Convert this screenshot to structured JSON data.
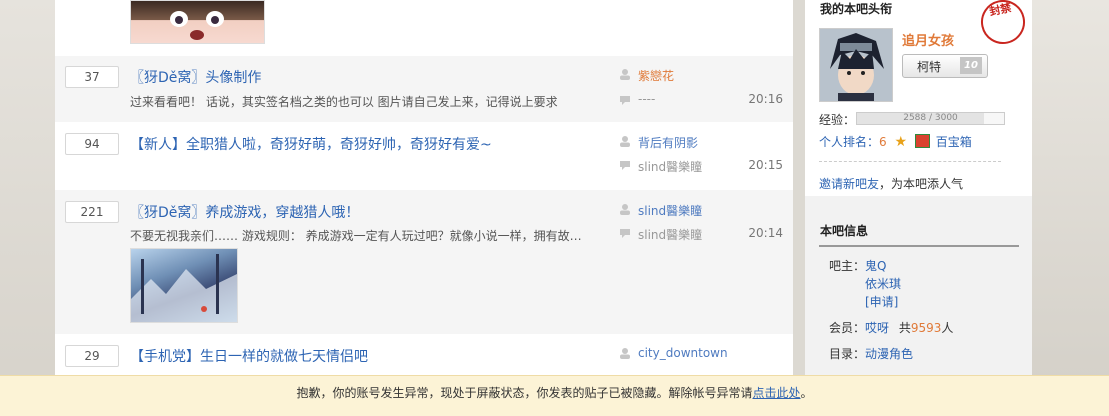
{
  "threads": [
    {
      "replies": "37",
      "title": "〖犽Dě窝〗头像制作",
      "abstract": "过来看看吧！ 话说，其实签名档之类的也可以 图片请自己发上来，记得说上要求",
      "author": "紫戀花",
      "last_replier": "----",
      "time": "20:16"
    },
    {
      "replies": "94",
      "title": "【新人】全职猎人啦，奇犽好萌，奇犽好帅，奇犽好有爱~",
      "author": "背后有阴影",
      "last_replier": "slind醫樂瞳",
      "time": "20:15"
    },
    {
      "replies": "221",
      "title": "〖犽Dě窝〗养成游戏，穿越猎人哦！",
      "abstract": "不要无视我亲们…… 游戏规则： 养成游戏一定有人玩过吧？就像小说一样，拥有故…",
      "author": "slind醫樂瞳",
      "last_replier": "slind醫樂瞳",
      "time": "20:14"
    },
    {
      "replies": "29",
      "title": "【手机党】生日一样的就做七天情侣吧",
      "author": "city_downtown",
      "last_replier": "",
      "time": ""
    }
  ],
  "sidebar": {
    "my_title_heading": "我的本吧头衔",
    "username": "追月女孩",
    "seal_text": "封禁",
    "badge_label": "柯特",
    "badge_level": "10",
    "exp_label": "经验：",
    "exp_value": "2588 / 3000",
    "exp_progress": 0.8627,
    "rank_label": "个人排名：",
    "rank_value": "6",
    "treasure_label": "百宝箱",
    "invite_link": "邀请新吧友",
    "invite_text": "，为本吧添人气",
    "info_heading": "本吧信息",
    "owner_label": "吧主：",
    "owners": [
      "鬼Q",
      "依米琪",
      "[申请]"
    ],
    "members_label": "会员：",
    "members_name": "哎呀",
    "members_total_prefix": "共",
    "members_count": "9593",
    "members_unit": "人",
    "catalog_label": "目录：",
    "catalog_value": "动漫角色"
  },
  "notice": {
    "text": "抱歉，你的账号发生异常，现处于屏蔽状态，你发表的贴子已被隐藏。解除帐号异常请",
    "link": "点击此处",
    "end": "。"
  }
}
